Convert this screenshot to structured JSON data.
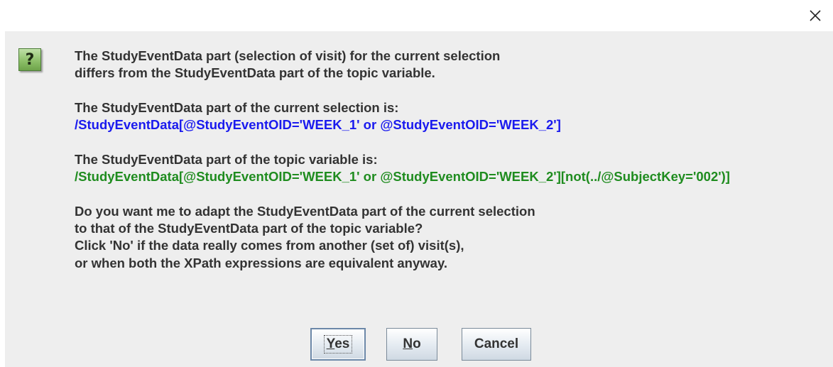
{
  "window": {
    "close_label": "✕"
  },
  "icon": {
    "name": "question-icon",
    "glyph": "?"
  },
  "message": {
    "p1_line1": "The StudyEventData part (selection of visit) for the current selection",
    "p1_line2": "differs from the StudyEventData part of the topic variable.",
    "p2_line1": "The StudyEventData part of the current selection is:",
    "p2_xpath": "/StudyEventData[@StudyEventOID='WEEK_1' or @StudyEventOID='WEEK_2']",
    "p3_line1": "The StudyEventData part of the topic variable is:",
    "p3_xpath": "/StudyEventData[@StudyEventOID='WEEK_1' or @StudyEventOID='WEEK_2'][not(../@SubjectKey='002')]",
    "p4_line1": "Do you want me to adapt the StudyEventData part of the current selection",
    "p4_line2": "to that of the StudyEventData part of the topic variable?",
    "p4_line3": "Click 'No' if the data really comes from another (set of) visit(s),",
    "p4_line4": "or when both the XPath expressions are equivalent anyway."
  },
  "buttons": {
    "yes_mnemonic": "Y",
    "yes_rest": "es",
    "no_mnemonic": "N",
    "no_rest": "o",
    "cancel_label": "Cancel"
  },
  "colors": {
    "current_selection_xpath": "#1a1aee",
    "topic_variable_xpath": "#1f8c1f",
    "dialog_background": "#eeeeee"
  }
}
